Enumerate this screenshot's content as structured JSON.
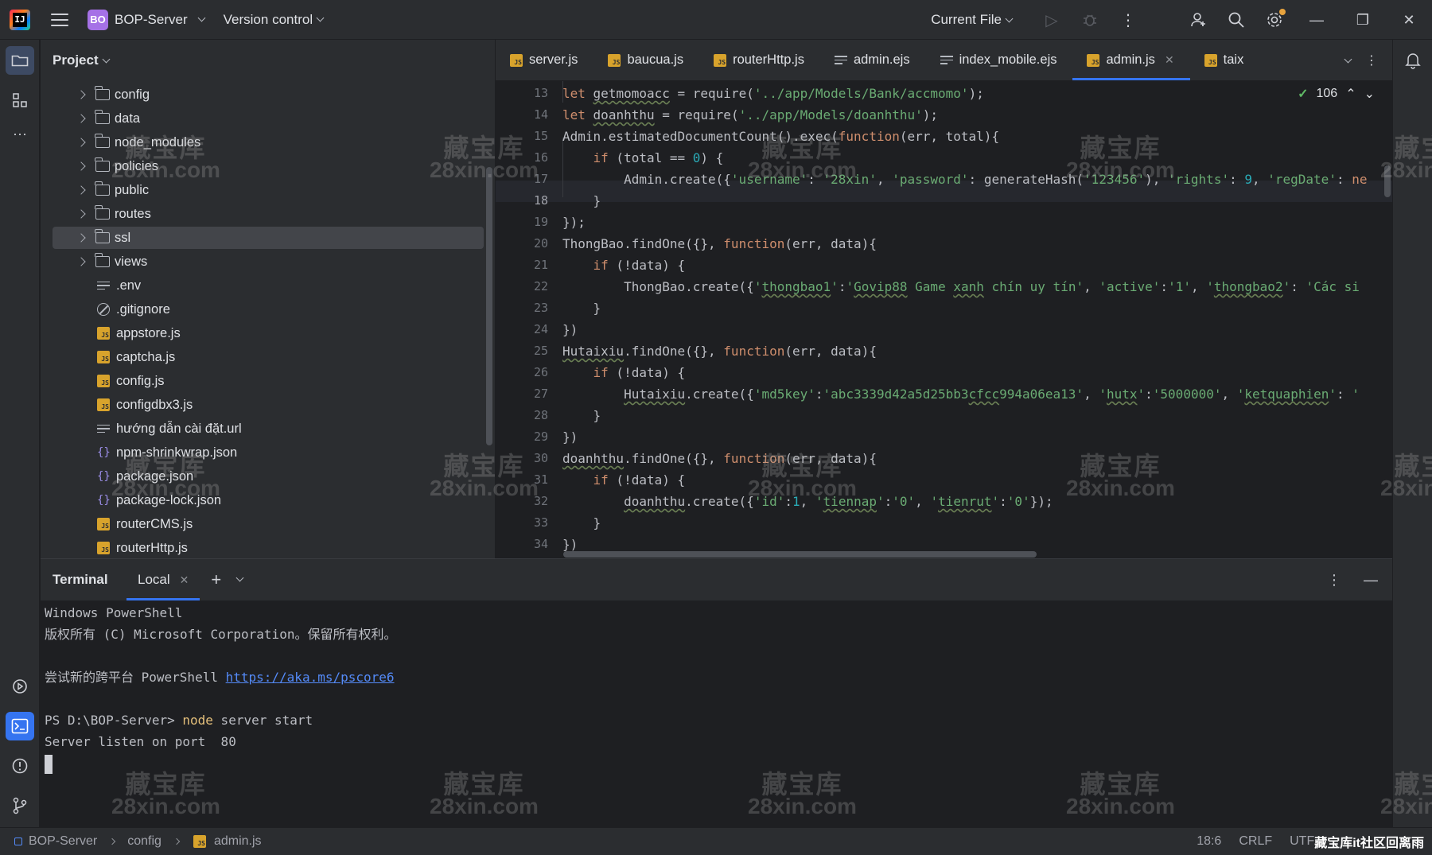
{
  "titlebar": {
    "logo_text": "IJ",
    "project_badge": "BO",
    "project_name": "BOP-Server",
    "vcs": "Version control",
    "run_config": "Current File"
  },
  "project_panel": {
    "title": "Project",
    "items": [
      {
        "label": "config",
        "type": "folder"
      },
      {
        "label": "data",
        "type": "folder"
      },
      {
        "label": "node_modules",
        "type": "folder"
      },
      {
        "label": "policies",
        "type": "folder"
      },
      {
        "label": "public",
        "type": "folder"
      },
      {
        "label": "routes",
        "type": "folder"
      },
      {
        "label": "ssl",
        "type": "folder",
        "selected": true
      },
      {
        "label": "views",
        "type": "folder"
      },
      {
        "label": ".env",
        "type": "text"
      },
      {
        "label": ".gitignore",
        "type": "ignore"
      },
      {
        "label": "appstore.js",
        "type": "js"
      },
      {
        "label": "captcha.js",
        "type": "js"
      },
      {
        "label": "config.js",
        "type": "js"
      },
      {
        "label": "configdbx3.js",
        "type": "js"
      },
      {
        "label": "hướng dẫn cài đặt.url",
        "type": "text"
      },
      {
        "label": "npm-shrinkwrap.json",
        "type": "json"
      },
      {
        "label": "package.json",
        "type": "json"
      },
      {
        "label": "package-lock.json",
        "type": "json"
      },
      {
        "label": "routerCMS.js",
        "type": "js"
      },
      {
        "label": "routerHttp.js",
        "type": "js"
      }
    ]
  },
  "editor": {
    "tabs": [
      {
        "label": "server.js",
        "type": "js"
      },
      {
        "label": "baucua.js",
        "type": "js"
      },
      {
        "label": "routerHttp.js",
        "type": "js"
      },
      {
        "label": "admin.ejs",
        "type": "text"
      },
      {
        "label": "index_mobile.ejs",
        "type": "text"
      },
      {
        "label": "admin.js",
        "type": "js",
        "active": true
      },
      {
        "label": "taix",
        "type": "js"
      }
    ],
    "inspection_count": "106",
    "line_numbers": [
      "13",
      "14",
      "15",
      "16",
      "17",
      "18",
      "19",
      "20",
      "21",
      "22",
      "23",
      "24",
      "25",
      "26",
      "27",
      "28",
      "29",
      "30",
      "31",
      "32",
      "33",
      "34"
    ],
    "current_line": "18"
  },
  "terminal": {
    "title": "Terminal",
    "tab": "Local",
    "lines": {
      "l1": "Windows PowerShell",
      "l2": "版权所有 (C) Microsoft Corporation。保留所有权利。",
      "l3_prefix": "尝试新的跨平台 PowerShell ",
      "l3_link": "https://aka.ms/pscore6",
      "prompt": "PS D:\\BOP-Server> ",
      "cmd": "node",
      "cmd_args": " server start",
      "l5": "Server listen on port  80"
    }
  },
  "statusbar": {
    "crumbs": [
      "BOP-Server",
      "config",
      "admin.js"
    ],
    "position": "18:6",
    "line_sep": "CRLF",
    "encoding": "UTF",
    "watermark_badge": "藏宝库it社区回离雨"
  },
  "watermark": {
    "line1": "藏宝库",
    "line2": "28xin.com"
  }
}
